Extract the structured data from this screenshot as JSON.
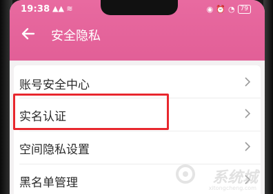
{
  "status_bar": {
    "time": "19:38",
    "left_icons": "▲▲ ≋",
    "battery": "79"
  },
  "header": {
    "title": "安全隐私"
  },
  "menu": [
    {
      "label": "账号安全中心"
    },
    {
      "label": "实名认证"
    },
    {
      "label": "空间隐私设置"
    },
    {
      "label": "黑名单管理"
    }
  ],
  "watermark": {
    "text": "系统城",
    "url": "xitongcheng.com"
  },
  "colors": {
    "header": "#e25f97",
    "highlight": "#e8262d"
  }
}
